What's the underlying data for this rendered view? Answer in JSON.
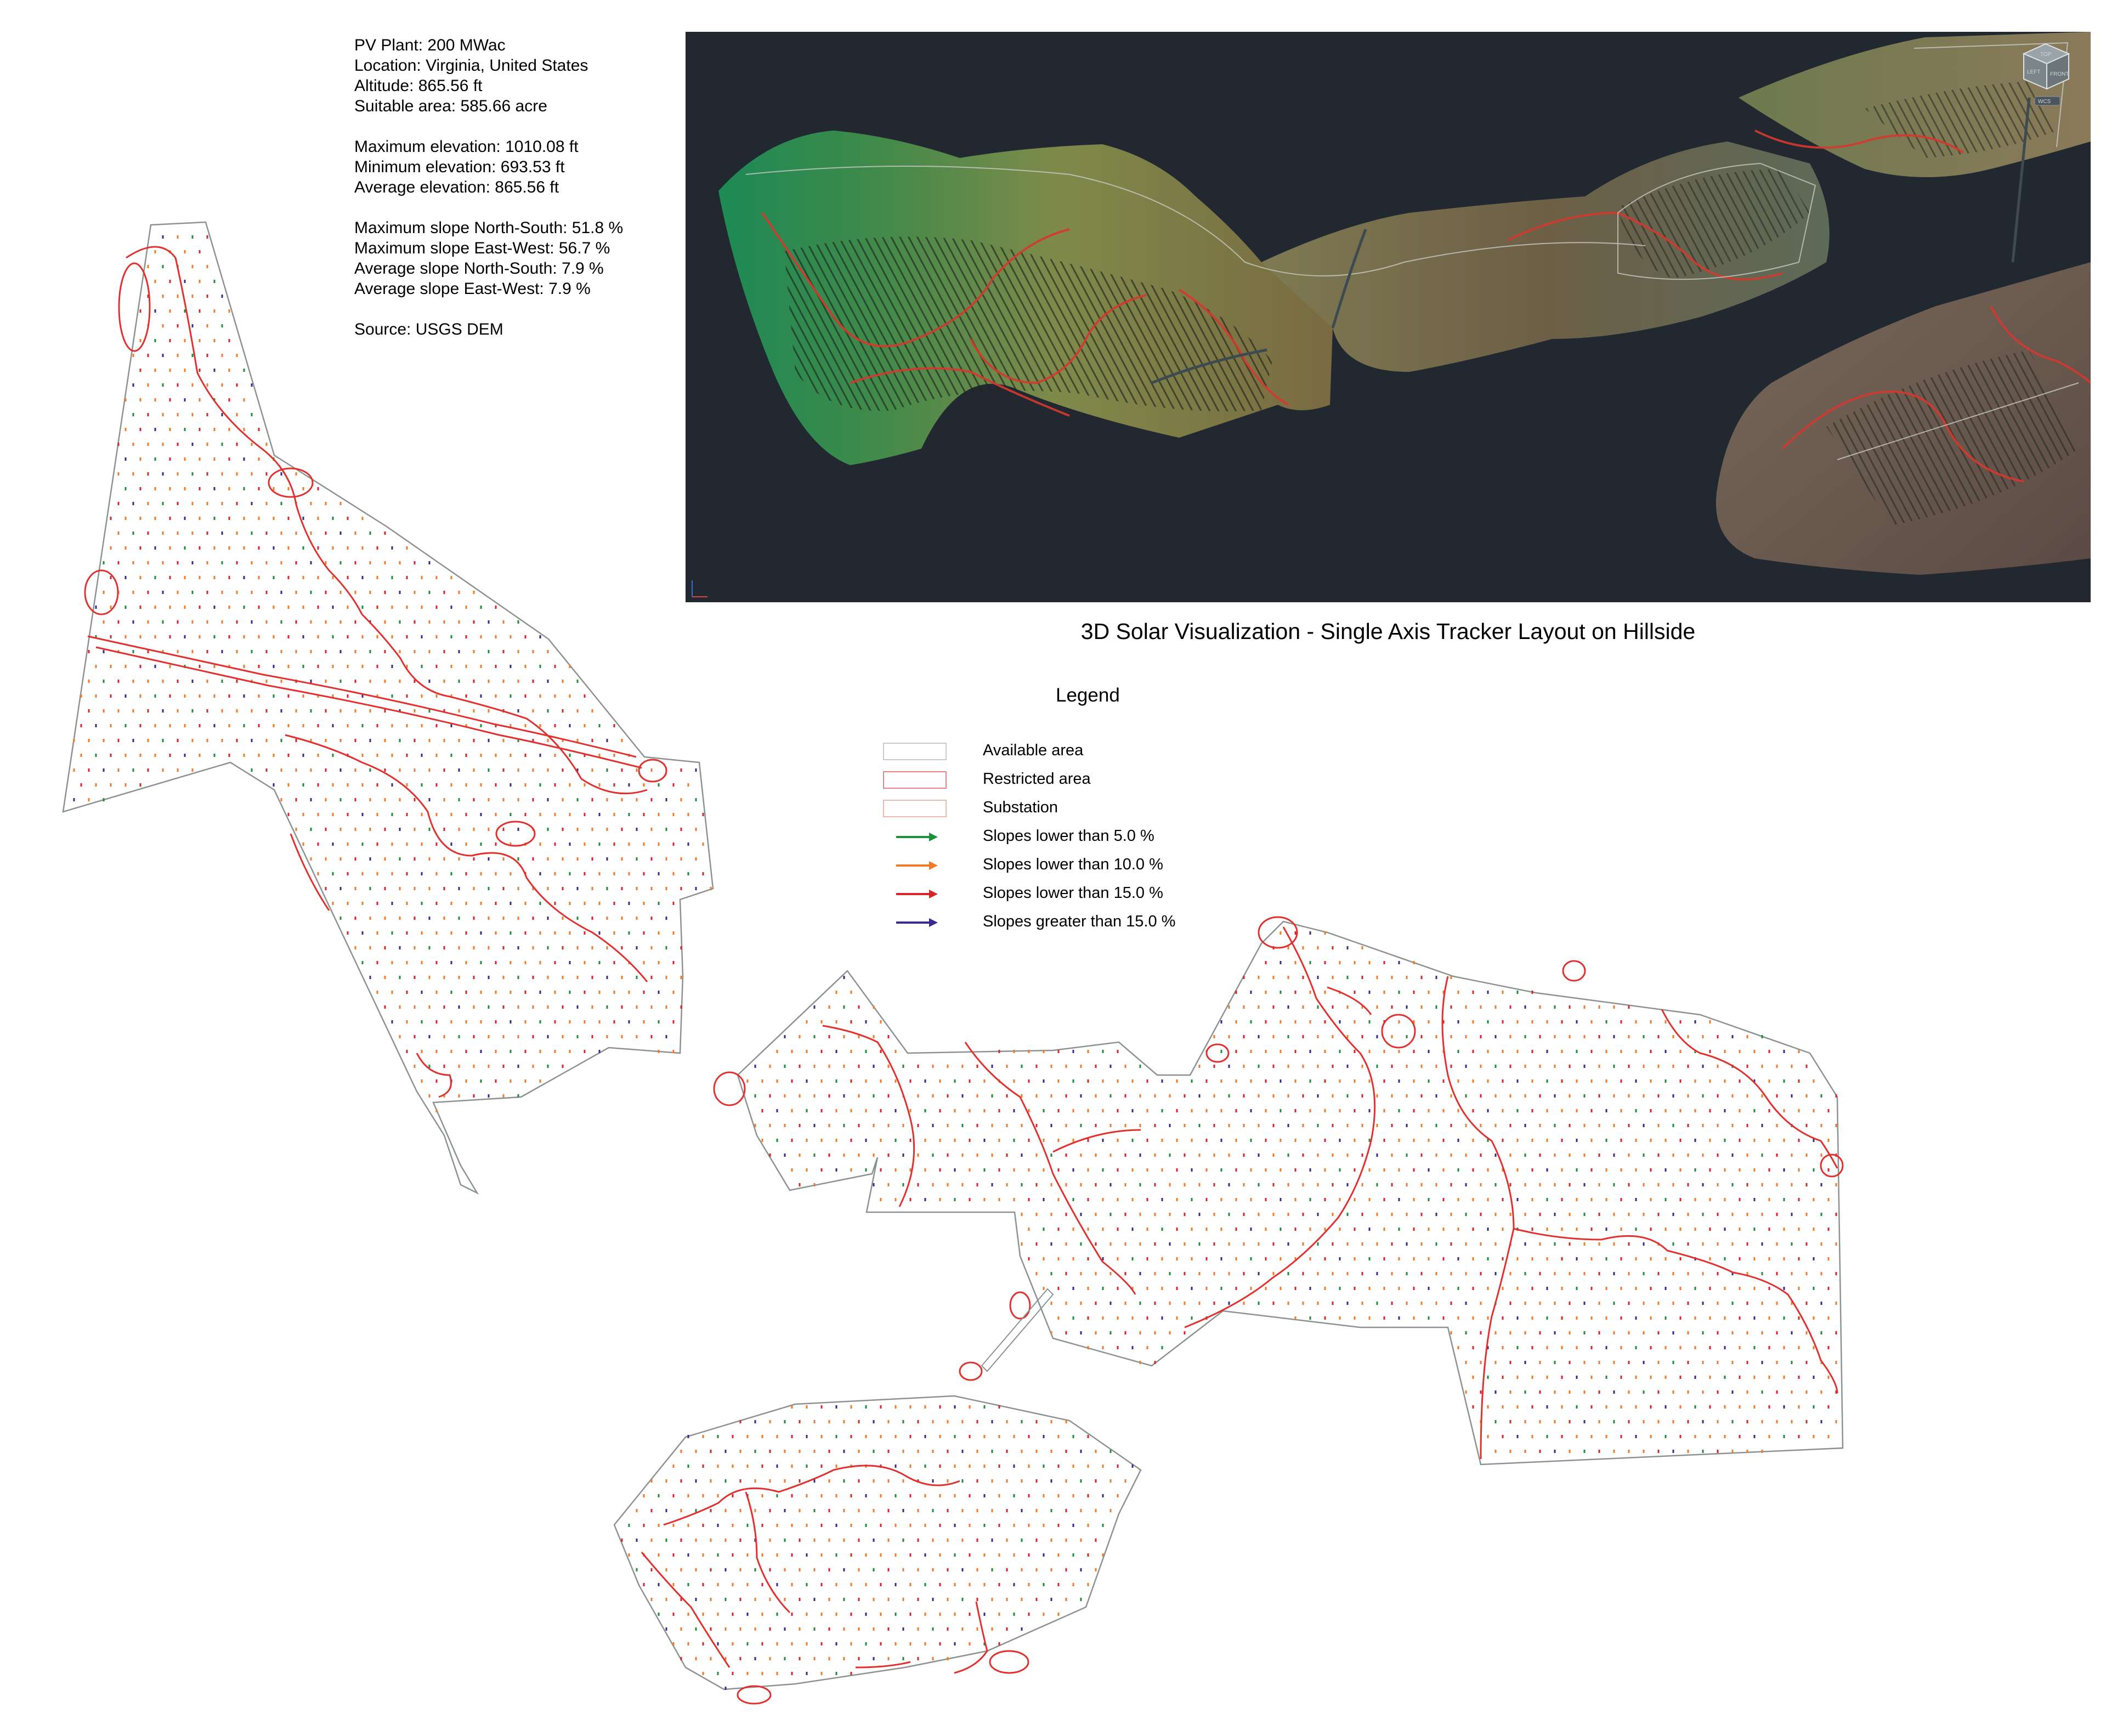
{
  "plant_info": {
    "lines": [
      "PV Plant: 200 MWac",
      "Location: Virginia, United States",
      "Altitude: 865.56 ft",
      "Suitable area: 585.66 acre",
      "",
      "Maximum elevation: 1010.08 ft",
      "Minimum elevation: 693.53 ft",
      "Average elevation: 865.56 ft",
      "",
      "Maximum slope North-South: 51.8 %",
      "Maximum slope East-West: 56.7 %",
      "Average slope North-South: 7.9 %",
      "Average slope East-West: 7.9 %",
      "",
      "Source: USGS DEM"
    ]
  },
  "viewport": {
    "caption": "3D Solar Visualization - Single Axis Tracker Layout on Hillside",
    "view_cube": {
      "top": "TOP",
      "left": "LEFT",
      "front": "FRONT",
      "wcs": "WCS"
    },
    "background_color": "#212830"
  },
  "legend": {
    "title": "Legend",
    "items": [
      {
        "label": "Available area",
        "kind": "box",
        "color": "#b8b8b8"
      },
      {
        "label": "Restricted area",
        "kind": "box",
        "color": "#e05a5a"
      },
      {
        "label": "Substation",
        "kind": "box",
        "color": "#e8a090"
      },
      {
        "label": "Slopes lower than 5.0 %",
        "kind": "arrow",
        "color": "#1f8f3a"
      },
      {
        "label": "Slopes lower than 10.0 %",
        "kind": "arrow",
        "color": "#f07a2a"
      },
      {
        "label": "Slopes lower than 15.0 %",
        "kind": "arrow",
        "color": "#d7262a"
      },
      {
        "label": "Slopes greater than 15.0 %",
        "kind": "arrow",
        "color": "#3a2a8f"
      }
    ]
  },
  "colors": {
    "boundary": "#8a9390",
    "restricted": "#e0312f",
    "slope_lt5": "#1f8f3a",
    "slope_lt10": "#f07a2a",
    "slope_lt15": "#d7262a",
    "slope_gt15": "#3a2a8f"
  }
}
